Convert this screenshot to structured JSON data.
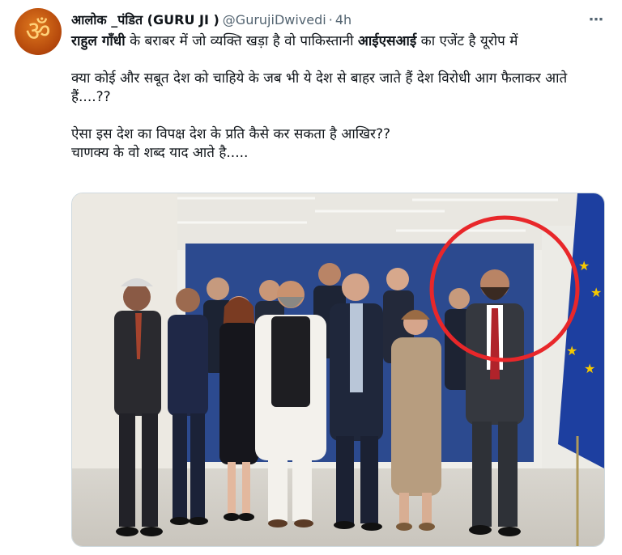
{
  "tweet": {
    "avatar_glyph": "ॐ",
    "author_name": "आलोक _पंडित (GURU JI )",
    "author_handle": "@GurujiDwivedi",
    "separator": "·",
    "time": "4h",
    "more_icon": "⋯",
    "line1_part1": "राहुल गाँधी",
    "line1_part2": " के बराबर में जो व्यक्ति खड़ा है वो पाकिस्तानी ",
    "line1_part3": "आईएसआई",
    "line1_part4": " का एजेंट है यूरोप में",
    "para2": "क्या कोई और सबूत देश को चाहिये के जब भी ये देश से बाहर जाते हैं देश विरोधी आग फैलाकर आते हैं....??",
    "para3_line1": "ऐसा इस देश का विपक्ष देश के प्रति कैसे कर सकता है आखिर??",
    "para3_line2": "चाणक्य के वो शब्द याद आते है....."
  },
  "colors": {
    "text": "#0f1419",
    "secondary": "#536471",
    "backdrop_blue": "#2c4a8f",
    "eu_flag": "#1d3fa0",
    "eu_star": "#f5c800",
    "highlight_circle": "#e8272a"
  }
}
